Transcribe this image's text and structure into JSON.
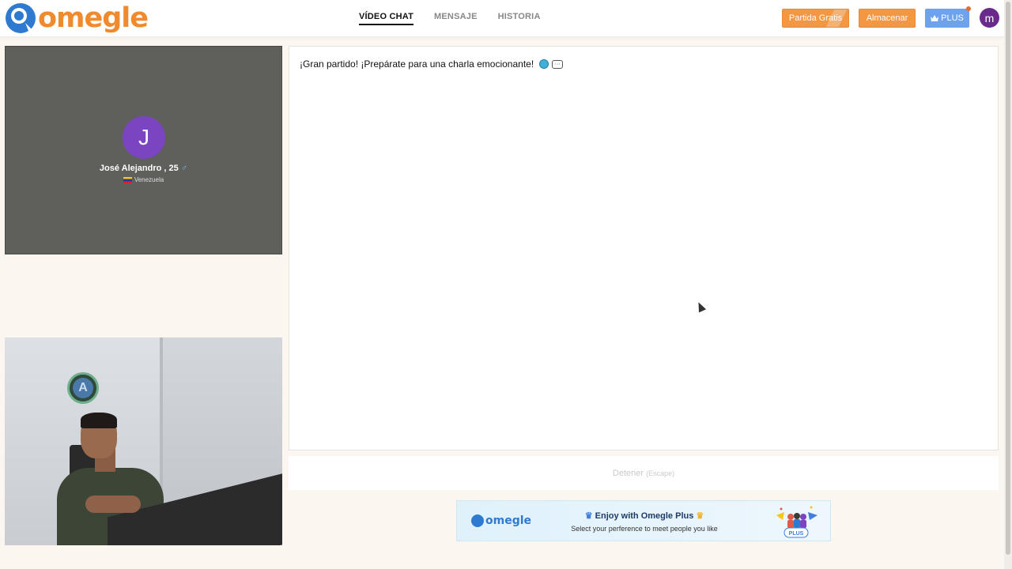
{
  "header": {
    "logo_text": "omegle",
    "nav": [
      {
        "label": "VÍDEO CHAT",
        "active": true
      },
      {
        "label": "MENSAJE",
        "active": false
      },
      {
        "label": "HISTORIA",
        "active": false
      }
    ],
    "free_match_label": "Partida Gratis",
    "store_label": "Almacenar",
    "plus_label": "PLUS",
    "user_initial": "m"
  },
  "partner": {
    "initial": "J",
    "name": "José Alejandro , 25",
    "gender_symbol": "♂",
    "country": "Venezuela"
  },
  "self_video": {
    "badge_letter": "A"
  },
  "chat": {
    "system_message": "¡Gran partido! ¡Prepárate para una charla emocionante!"
  },
  "stop": {
    "label": "Detener",
    "hint": "(Escape)"
  },
  "banner": {
    "logo_text": "omegle",
    "title": "Enjoy with Omegle Plus",
    "subtitle": "Select your perference to meet people you like",
    "art_badge": "PLUS"
  },
  "colors": {
    "brand_orange": "#f08a2c",
    "brand_blue": "#2e7ad0",
    "partner_avatar": "#7b45c2",
    "plus_blue": "#6ea3ec"
  }
}
